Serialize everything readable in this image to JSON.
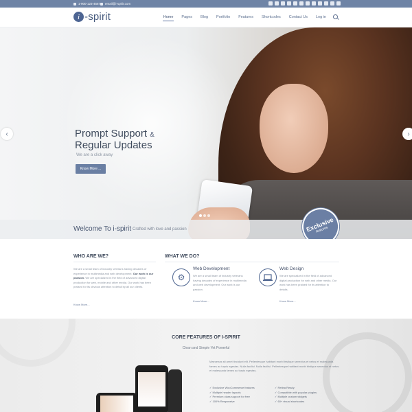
{
  "topbar": {
    "phone": "1-900-123-4567",
    "email": "email@i-spirit.com",
    "social_icons": [
      "twitter-icon",
      "facebook-icon",
      "google-plus-icon",
      "pinterest-icon",
      "flickr-icon",
      "dribbble-icon",
      "vimeo-icon",
      "youtube-icon",
      "instagram-icon",
      "skype-icon",
      "rss-icon",
      "linkedin-icon"
    ]
  },
  "header": {
    "logo_letter": "i",
    "logo_text": "-spirit",
    "nav": [
      "Home",
      "Pages",
      "Blog",
      "Portfolio",
      "Features",
      "Shortcodes",
      "Contact Us",
      "Log in"
    ]
  },
  "hero": {
    "title_line1": "Prompt Support",
    "title_amp": "&",
    "title_line2": "Regular Updates",
    "subtitle": "We are a click away",
    "button": "Know More ...",
    "welcome_title": "Welcome To i-spirit",
    "welcome_sub": "Crafted with love and passion",
    "badge_title": "Exclusive",
    "badge_sub": "features"
  },
  "who": {
    "heading": "WHO ARE WE?",
    "p1": "We are a small team of industry veterans having decades of experience in multimedia and web development.",
    "p1_bold": "Our work is our passion.",
    "p2": "We are specialized in the field of advanced digital production for web, mobile and other media. Our work has been praised for its obvious attention to detail by all our clients.",
    "more": "Know More..."
  },
  "what": {
    "heading": "WHAT WE DO?",
    "services": [
      {
        "title": "Web Development",
        "text": "We are a small team of industry veterans having decades of experience in multimedia and web development. Our work is our passion.",
        "more": "Know More..."
      },
      {
        "title": "Web Design",
        "text": "We are specialized in the field of advanced digital production for web and other media. Our work has been praised for its attention to details.",
        "more": "Know More..."
      }
    ]
  },
  "features": {
    "title": "CORE FEATURES OF I-SPIRIT",
    "subtitle": "Clean and Simple Yet Powerful",
    "lorem": "Maecenas sit amet tincidunt elit. Pellentesque habitant morbi tristique senectus et netus et malesuada fames ac turpis egestas. Nulla facilisi. Nulla facilisi. Pellentesque habitant morbi tristique senectus et netus et malesuada fames ac turpis egestas.",
    "list_left": [
      "Exclusive WooCommerce features",
      "Multiple header layouts",
      "Premium class support for free",
      "100% Responsive"
    ],
    "list_right": [
      "Retina Ready",
      "Compatible with popular plugins",
      "Multiple custom widgets",
      "60+ visual shortcodes"
    ]
  }
}
